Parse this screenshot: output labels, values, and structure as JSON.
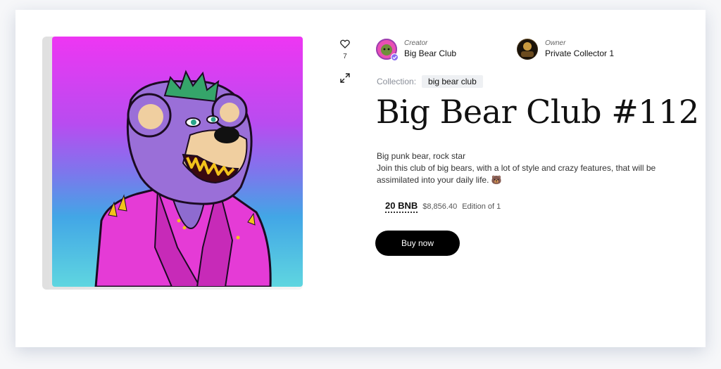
{
  "nft": {
    "likes": "7",
    "title": "Big Bear Club #112",
    "description_line1": "Big punk bear, rock star",
    "description_line2": "Join this club of big bears, with a lot of style and crazy features, that will be assimilated into your daily life. 🐻",
    "artwork_alt": "Big Bear Club #112"
  },
  "creator": {
    "role": "Creator",
    "name": "Big Bear Club"
  },
  "owner": {
    "role": "Owner",
    "name": "Private Collector 1"
  },
  "collection": {
    "label": "Collection:",
    "tag": "big bear club"
  },
  "price": {
    "bnb": "20 BNB",
    "usd": "$8,856.40",
    "edition": "Edition of 1"
  },
  "actions": {
    "buy_label": "Buy now"
  },
  "icons": {
    "like": "heart-icon",
    "expand": "expand-icon",
    "verified": "verified-check-icon"
  },
  "colors": {
    "button_bg": "#000000",
    "verified": "#8a6cf2",
    "art_top": "#ee36f3",
    "art_bottom": "#5fd6e0"
  }
}
